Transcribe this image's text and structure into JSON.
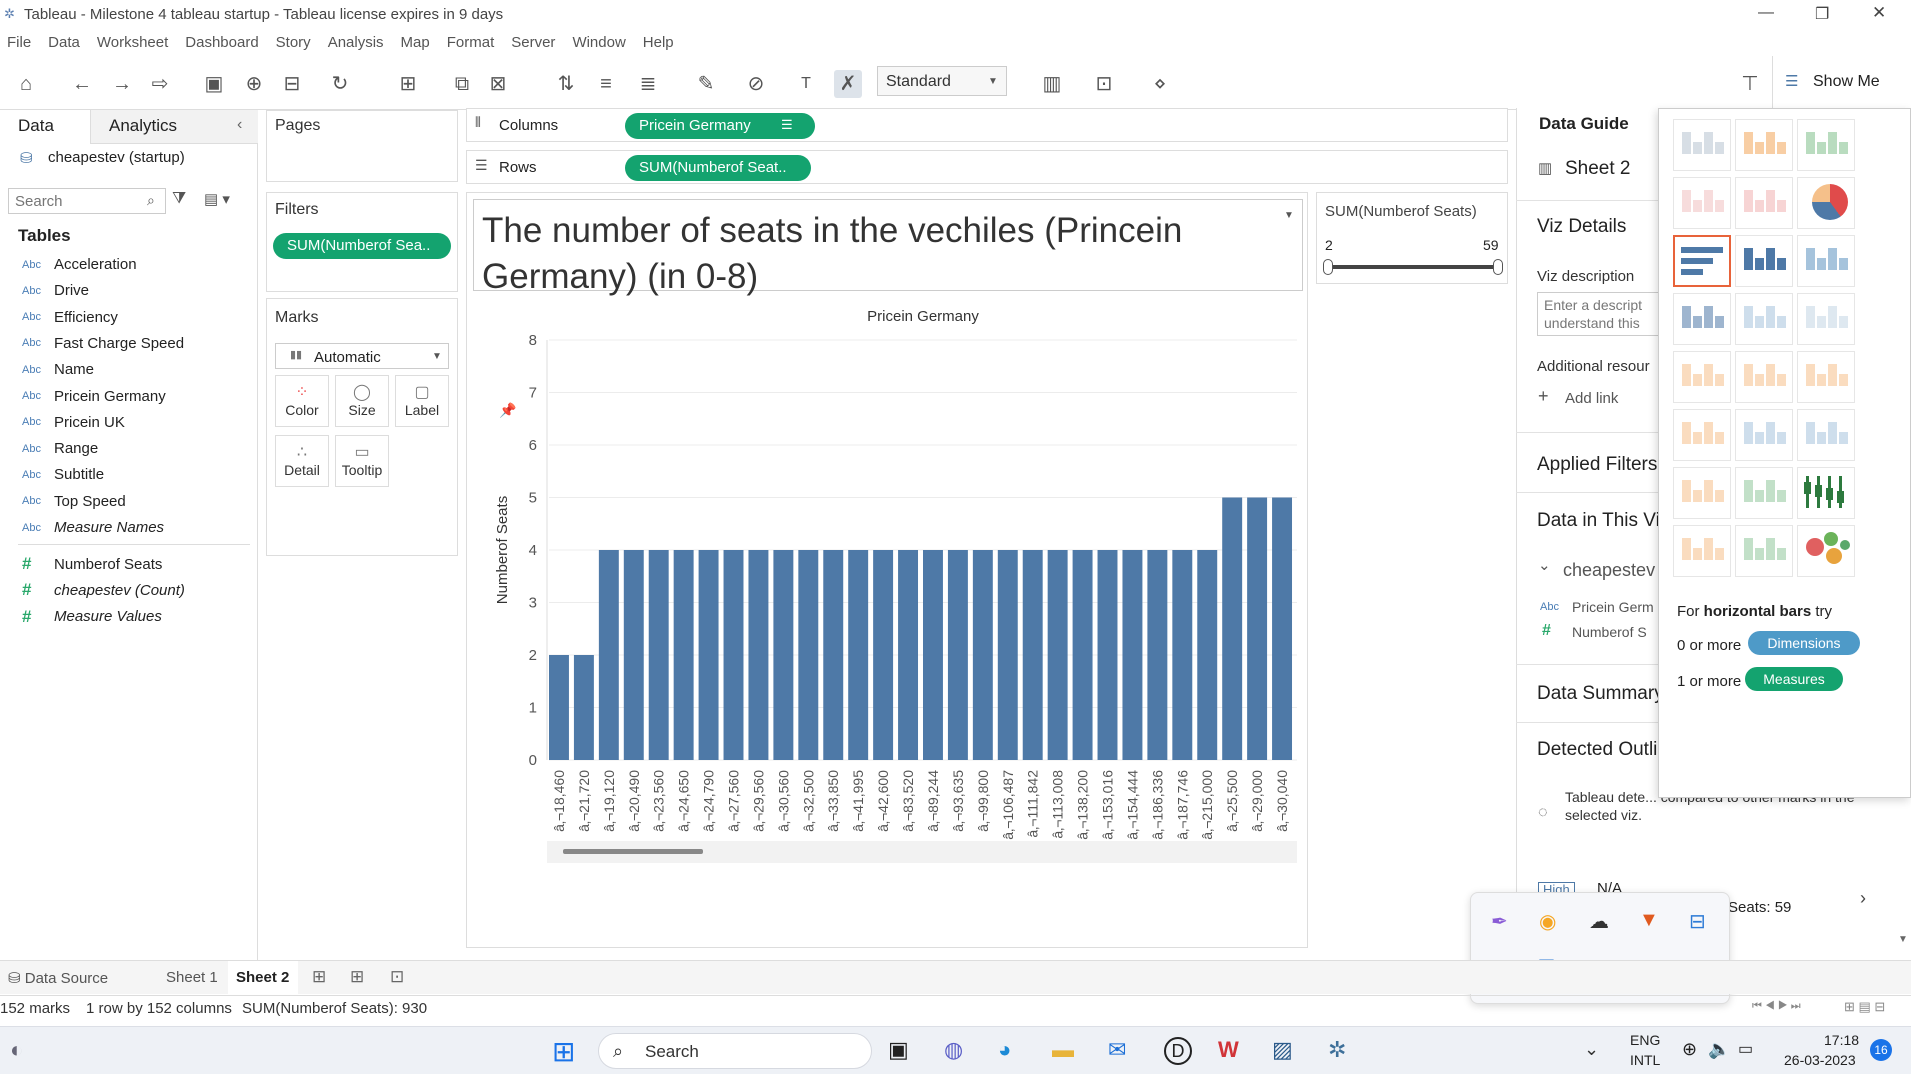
{
  "window": {
    "title": "Tableau - Milestone 4 tableau startup - Tableau license expires in 9 days",
    "controls": [
      "—",
      "❐",
      "✕"
    ]
  },
  "menu": [
    "File",
    "Data",
    "Worksheet",
    "Dashboard",
    "Story",
    "Analysis",
    "Map",
    "Format",
    "Server",
    "Window",
    "Help"
  ],
  "toolbar": {
    "fit_label": "Standard",
    "show_me_label": "Show Me"
  },
  "left_panel": {
    "tabs": [
      "Data",
      "Analytics"
    ],
    "datasource": "cheapestev (startup)",
    "search_placeholder": "Search",
    "tables_label": "Tables",
    "dimensions": [
      {
        "type": "Abc",
        "name": "Acceleration"
      },
      {
        "type": "Abc",
        "name": "Drive"
      },
      {
        "type": "Abc",
        "name": "Efficiency"
      },
      {
        "type": "Abc",
        "name": "Fast Charge Speed"
      },
      {
        "type": "Abc",
        "name": "Name"
      },
      {
        "type": "Abc",
        "name": "Pricein Germany"
      },
      {
        "type": "Abc",
        "name": "Pricein UK"
      },
      {
        "type": "Abc",
        "name": "Range"
      },
      {
        "type": "Abc",
        "name": "Subtitle"
      },
      {
        "type": "Abc",
        "name": "Top Speed"
      },
      {
        "type": "Abc",
        "name": "Measure Names"
      }
    ],
    "measures": [
      {
        "type": "#",
        "name": "Numberof Seats"
      },
      {
        "type": "#",
        "name": "cheapestev (Count)"
      },
      {
        "type": "#",
        "name": "Measure Values"
      }
    ]
  },
  "pages_label": "Pages",
  "filters": {
    "label": "Filters",
    "pill": "SUM(Numberof Sea.."
  },
  "marks": {
    "label": "Marks",
    "type": "Automatic",
    "buttons": [
      "Color",
      "Size",
      "Label",
      "Detail",
      "Tooltip"
    ]
  },
  "shelves": {
    "columns_label": "Columns",
    "columns_pill": "Pricein Germany",
    "rows_label": "Rows",
    "rows_pill": "SUM(Numberof Seat.."
  },
  "viz_title": "The number of seats in the vechiles (Princein Germany) (in 0-8)",
  "range_filter": {
    "title": "SUM(Numberof Seats)",
    "min": "2",
    "max": "59"
  },
  "chart_data": {
    "type": "bar",
    "title": "Pricein Germany",
    "xlabel": "",
    "ylabel": "Numberof Seats",
    "ylim": [
      0,
      8
    ],
    "yticks": [
      0,
      1,
      2,
      3,
      4,
      5,
      6,
      7,
      8
    ],
    "grid": true,
    "categories": [
      "â‚¬18,460",
      "â‚¬21,720",
      "â‚¬19,120",
      "â‚¬20,490",
      "â‚¬23,560",
      "â‚¬24,650",
      "â‚¬24,790",
      "â‚¬27,560",
      "â‚¬29,560",
      "â‚¬30,560",
      "â‚¬32,500",
      "â‚¬33,850",
      "â‚¬41,995",
      "â‚¬42,600",
      "â‚¬83,520",
      "â‚¬89,244",
      "â‚¬93,635",
      "â‚¬99,800",
      "â‚¬106,487",
      "â‚¬111,842",
      "â‚¬113,008",
      "â‚¬138,200",
      "â‚¬153,016",
      "â‚¬154,444",
      "â‚¬186,336",
      "â‚¬187,746",
      "â‚¬215,000",
      "â‚¬25,500",
      "â‚¬29,000",
      "â‚¬30,040"
    ],
    "values": [
      2,
      2,
      4,
      4,
      4,
      4,
      4,
      4,
      4,
      4,
      4,
      4,
      4,
      4,
      4,
      4,
      4,
      4,
      4,
      4,
      4,
      4,
      4,
      4,
      4,
      4,
      4,
      5,
      5,
      5
    ]
  },
  "data_guide": {
    "title": "Data Guide",
    "sheet": "Sheet 2",
    "viz_details": "Viz Details",
    "viz_description": "Viz description",
    "desc_placeholder": "Enter a descript understand this",
    "additional": "Additional resour",
    "add_link": "Add link",
    "applied_filters": "Applied Filters",
    "data_in_viz": "Data in This Vi",
    "source": "cheapestev",
    "fields": [
      "Pricein Germ",
      "Numberof S"
    ],
    "summary": "Data Summary",
    "outliers": "Detected Outli",
    "outlier_text": "Tableau dete... compared to other marks in the selected viz.",
    "high": "High",
    "na": "N/A",
    "seats": "Seats: 59"
  },
  "show_me": {
    "hint_prefix": "For ",
    "hint_bold": "horizontal bars",
    "hint_suffix": " try",
    "dim_prefix": "0 or more",
    "dim_pill": "Dimensions",
    "meas_prefix": "1 or more",
    "meas_pill": "Measures"
  },
  "sheet_tabs": [
    "Data Source",
    "Sheet 1",
    "Sheet 2"
  ],
  "status": {
    "marks": "152 marks",
    "dims": "1 row by 152 columns",
    "sum": "SUM(Numberof Seats): 930"
  },
  "taskbar": {
    "search": "Search",
    "lang1": "ENG",
    "lang2": "INTL",
    "time": "17:18",
    "date": "26-03-2023",
    "badge": "16"
  }
}
